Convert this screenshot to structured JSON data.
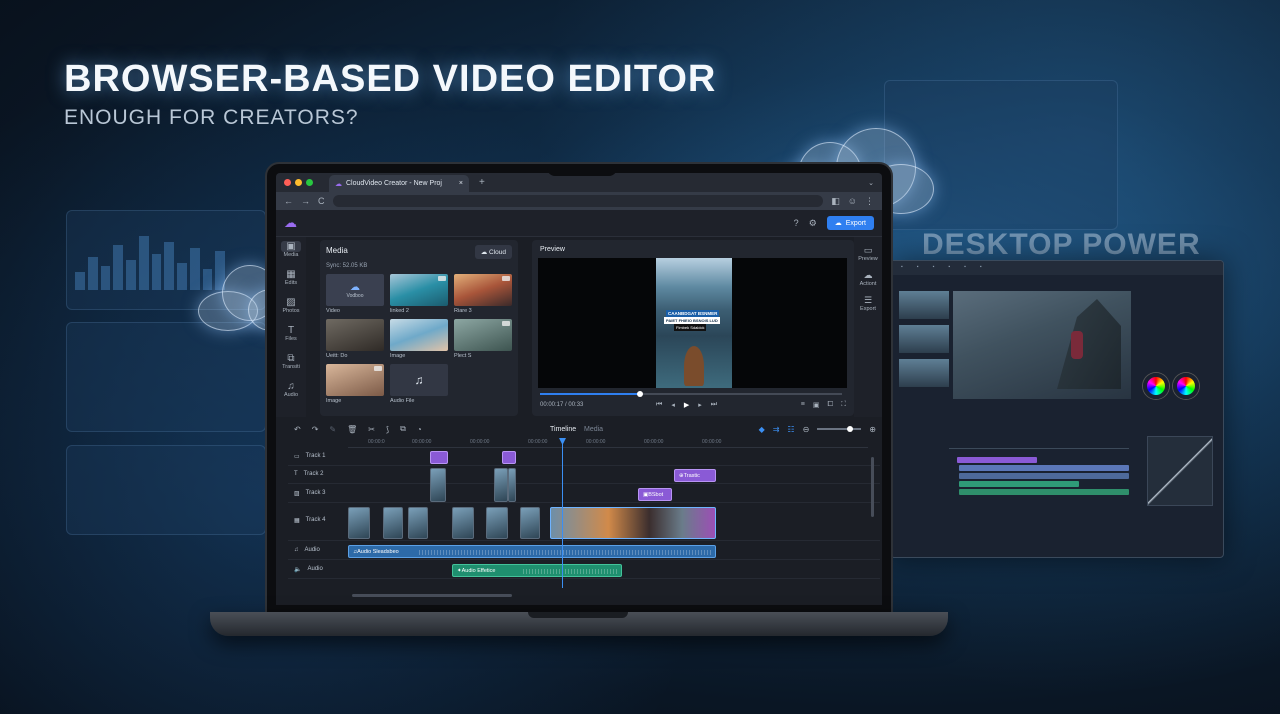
{
  "hero": {
    "headline": "BROWSER-BASED VIDEO EDITOR",
    "subhead": "ENOUGH FOR CREATORS?",
    "desktop_label": "DESKTOP POWER"
  },
  "browser": {
    "tab_title": "CloudVideo Creator - New Proj",
    "new_tab": "+",
    "back": "←",
    "forward": "→",
    "reload": "C"
  },
  "app": {
    "export_label": "Export",
    "left_nav": [
      {
        "icon": "media-icon",
        "glyph": "▣",
        "label": "Media"
      },
      {
        "icon": "grid-icon",
        "glyph": "▦",
        "label": "Edits"
      },
      {
        "icon": "photo-icon",
        "glyph": "▨",
        "label": "Photos"
      },
      {
        "icon": "text-icon",
        "glyph": "T",
        "label": "Files"
      },
      {
        "icon": "transition-icon",
        "glyph": "⧉",
        "label": "Transiti"
      },
      {
        "icon": "audio-icon",
        "glyph": "♫",
        "label": "Audio"
      }
    ],
    "right_nav": [
      {
        "icon": "preview-icon",
        "glyph": "▭",
        "label": "Preview"
      },
      {
        "icon": "cloud-icon",
        "glyph": "☁",
        "label": "Actiont"
      },
      {
        "icon": "sliders-icon",
        "glyph": "☰",
        "label": "Export"
      }
    ],
    "media": {
      "title": "Media",
      "cloud_button": "Cloud",
      "sync": "Sync:   52.05 KB",
      "items": [
        {
          "caption": "Video",
          "label": "Vodboo"
        },
        {
          "caption": "linked 2",
          "label": ""
        },
        {
          "caption": "Riare 3",
          "label": ""
        },
        {
          "caption": "Ueitt: Do",
          "label": ""
        },
        {
          "caption": "Image",
          "label": ""
        },
        {
          "caption": "Plect S",
          "label": ""
        },
        {
          "caption": "Image",
          "label": ""
        },
        {
          "caption": "Audio File",
          "label": ""
        }
      ]
    },
    "preview": {
      "title": "Preview",
      "caption1": "CAANBDGAT BSNMER",
      "caption2": "PAIET FHIEIO BSNOIS LUD",
      "caption3": "Fimbek Sdaldck",
      "time": "00:00:17 / 00:33",
      "progress": 0.33
    },
    "timeline": {
      "title": "Timeline",
      "media_tab": "Media",
      "ruler": [
        "00:00:0",
        "00:00:00",
        "00:00:00",
        "00:00:00",
        "00:00:00",
        "00:00:00",
        "00:00:00"
      ],
      "tracks": [
        "Track 1",
        "Track 2",
        "Track 3",
        "Track 4",
        "Audio",
        "Audio"
      ],
      "clip_trastic": "Trastic",
      "clip_bsbot": "BSbot",
      "audio_clip_1": "Audio Sleadsbeo",
      "audio_clip_2": "Audio Effetice"
    }
  },
  "colors": {
    "accent": "#2f7ff0",
    "purple_clip": "#8a5ad6",
    "audio_blue": "#2d6aa8",
    "audio_green": "#1f8f6f"
  }
}
